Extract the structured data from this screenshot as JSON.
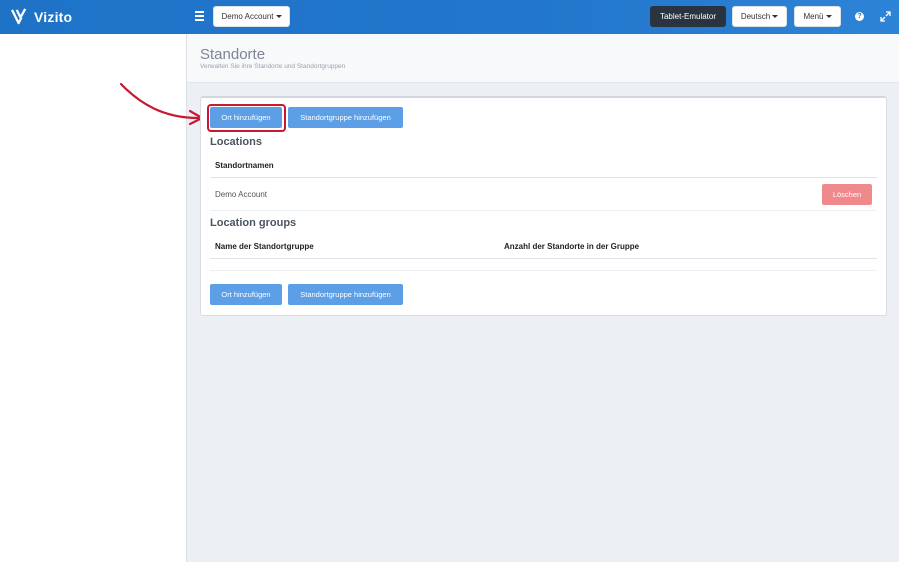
{
  "app": {
    "logo_text": "Vizito",
    "brand_color": "#2277cc"
  },
  "topbar": {
    "account_label": "Demo Account",
    "tablet_emulator_label": "Tablet-Emulator",
    "language_label": "Deutsch",
    "menu_label": "Menü",
    "help_glyph": "?",
    "icons": [
      "menu-icon",
      "help-icon",
      "expand-icon"
    ]
  },
  "page": {
    "title": "Standorte",
    "subtitle": "Verwalten Sie ihre Standorte und Standortgruppen"
  },
  "actions": {
    "add_location": "Ort hinzufügen",
    "add_group": "Standortgruppe hinzufügen"
  },
  "locations": {
    "title": "Locations",
    "columns": [
      "Standortnamen"
    ],
    "rows": [
      {
        "name": "Demo Account",
        "delete_label": "Löschen"
      }
    ]
  },
  "location_groups": {
    "title": "Location groups",
    "columns": [
      "Name der Standortgruppe",
      "Anzahl der Standorte in der Gruppe"
    ],
    "rows": []
  },
  "colors": {
    "primary_button": "#5d9fe6",
    "danger_button": "#f0898b",
    "highlight": "#c8192e",
    "dark_button": "#2a3440"
  }
}
